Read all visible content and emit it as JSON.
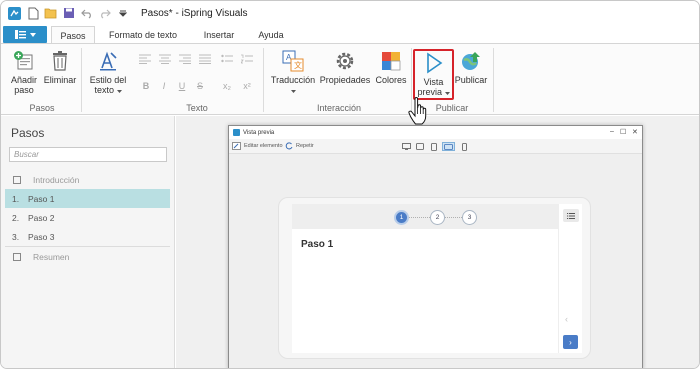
{
  "window": {
    "title": "Pasos* - iSpring Visuals"
  },
  "tabs": {
    "file_icon": "menu-icon",
    "items": [
      {
        "label": "Pasos"
      },
      {
        "label": "Formato de texto"
      },
      {
        "label": "Insertar"
      },
      {
        "label": "Ayuda"
      }
    ]
  },
  "ribbon": {
    "add_step": "Añadir paso",
    "add_step_l1": "Añadir",
    "add_step_l2": "paso",
    "delete": "Eliminar",
    "text_style_l1": "Estilo del",
    "text_style_l2": "texto",
    "translation": "Traducción",
    "properties": "Propiedades",
    "colors": "Colores",
    "preview_l1": "Vista",
    "preview_l2": "previa",
    "publish": "Publicar",
    "groups": {
      "steps": "Pasos",
      "text": "Texto",
      "interaction": "Interacción",
      "publish": "Publicar"
    },
    "format_glyphs": {
      "bold": "B",
      "italic": "I",
      "underline": "U",
      "strike": "S",
      "subscript": "x₂",
      "superscript": "x²"
    },
    "highlight_color": "#d6232a"
  },
  "left_panel": {
    "title": "Pasos",
    "search_placeholder": "Buscar",
    "items": [
      {
        "num": "",
        "label": "Introducción"
      },
      {
        "num": "1.",
        "label": "Paso 1"
      },
      {
        "num": "2.",
        "label": "Paso 2"
      },
      {
        "num": "3.",
        "label": "Paso 3"
      },
      {
        "num": "",
        "label": "Resumen"
      }
    ],
    "selected_color": "#b9dfe2"
  },
  "preview": {
    "title": "Vista previa",
    "edit": "Editar elemento",
    "replay": "Repetir",
    "steps": [
      "1",
      "2",
      "3"
    ],
    "heading": "Paso 1",
    "accent": "#4a7cc7",
    "prev_glyph": "‹",
    "next_glyph": "›",
    "win_min": "–",
    "win_max": "☐",
    "win_close": "✕"
  }
}
